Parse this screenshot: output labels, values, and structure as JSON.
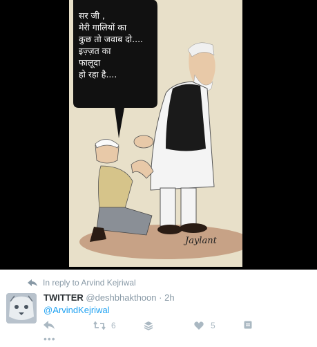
{
  "cartoon": {
    "speech_lines": [
      "सर जी ,",
      "मेरी गालियों का",
      "कुछ तो जवाब दो....",
      "इज़्ज़त का",
      "फालूदा",
      "हो रहा है...."
    ],
    "signature": "Jaylant"
  },
  "tweet": {
    "reply_context": "In reply to Arvind Kejriwal",
    "display_name": "TWITTER",
    "handle": "@deshbhakthoon",
    "separator": "·",
    "time": "2h",
    "mention": "@ArvindKejriwal",
    "retweet_count": "6",
    "like_count": "5",
    "more_label": "•••",
    "icons": [
      "reply-icon",
      "retweet-icon",
      "stack-icon",
      "heart-icon",
      "media-icon",
      "more-icon"
    ]
  },
  "colors": {
    "link": "#1da1f2",
    "muted": "#8899a6",
    "icon": "#aab8c2",
    "media_bg": "#000000"
  }
}
